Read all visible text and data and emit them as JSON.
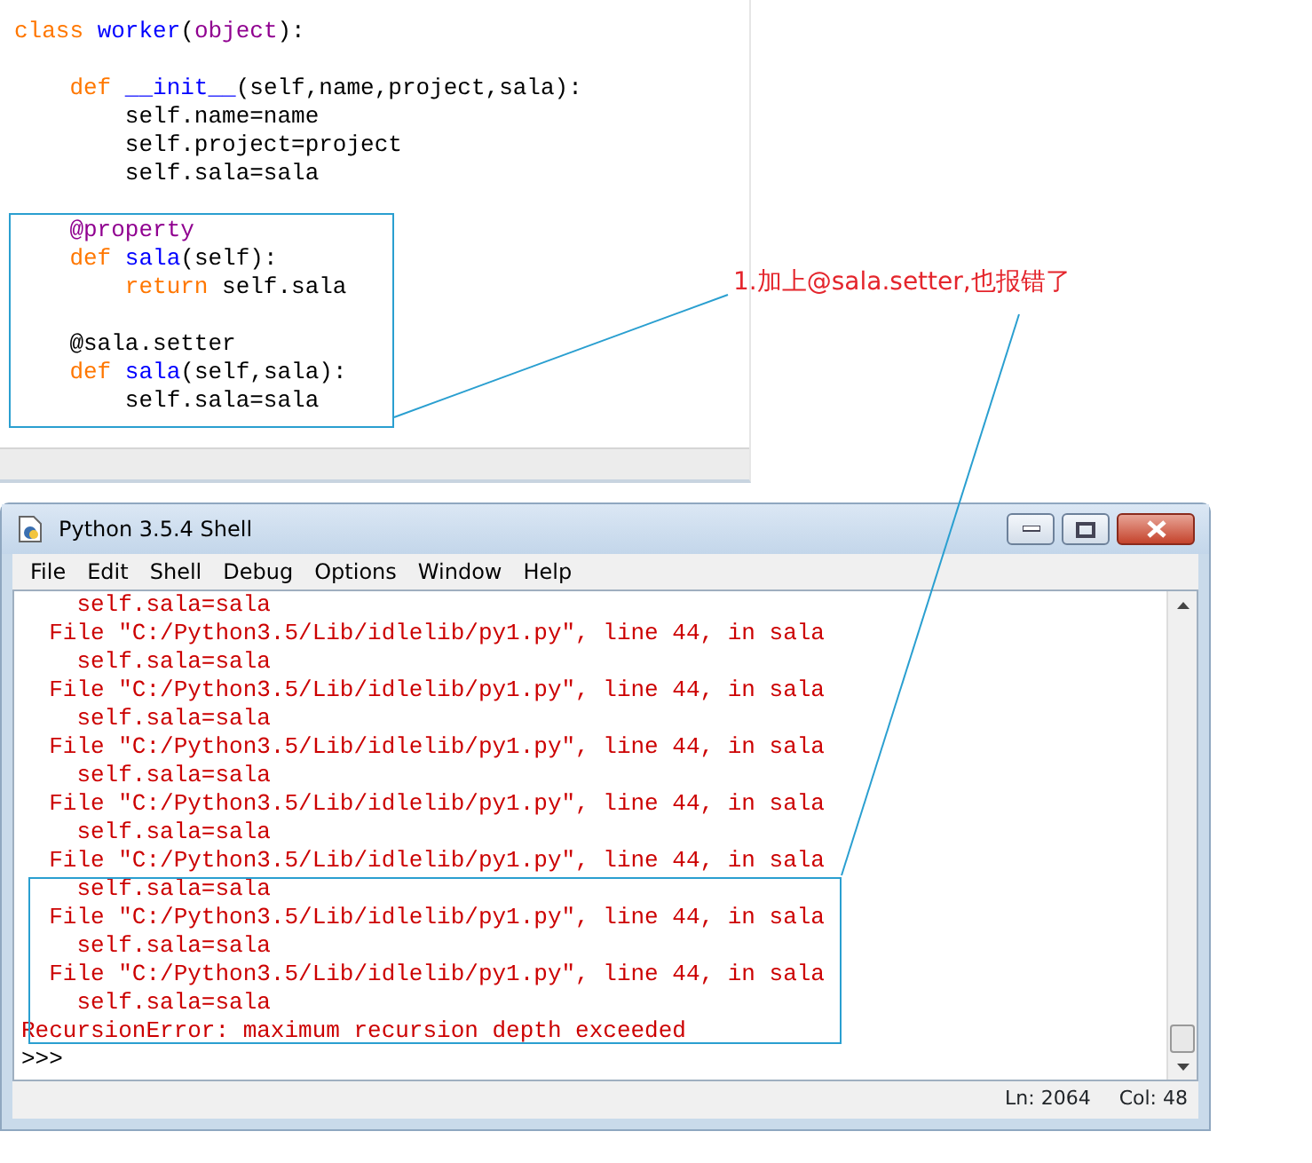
{
  "editor": {
    "lines": [
      {
        "gap_before": false,
        "tokens": [
          {
            "text": "class ",
            "kind": "keyword"
          },
          {
            "text": "worker",
            "kind": "definition"
          },
          {
            "text": "(",
            "kind": "plain"
          },
          {
            "text": "object",
            "kind": "builtin"
          },
          {
            "text": "):",
            "kind": "plain"
          }
        ]
      },
      {
        "gap_before": true,
        "tokens": [
          {
            "text": "    def ",
            "kind": "keyword"
          },
          {
            "text": "__init__",
            "kind": "definition"
          },
          {
            "text": "(self,name,project,sala):",
            "kind": "plain"
          }
        ]
      },
      {
        "gap_before": false,
        "tokens": [
          {
            "text": "        self.name=name",
            "kind": "plain"
          }
        ]
      },
      {
        "gap_before": false,
        "tokens": [
          {
            "text": "        self.project=project",
            "kind": "plain"
          }
        ]
      },
      {
        "gap_before": false,
        "tokens": [
          {
            "text": "        self.sala=sala",
            "kind": "plain"
          }
        ]
      },
      {
        "gap_before": true,
        "tokens": [
          {
            "text": "    @property",
            "kind": "builtin"
          }
        ]
      },
      {
        "gap_before": false,
        "tokens": [
          {
            "text": "    def ",
            "kind": "keyword"
          },
          {
            "text": "sala",
            "kind": "definition"
          },
          {
            "text": "(self):",
            "kind": "plain"
          }
        ]
      },
      {
        "gap_before": false,
        "tokens": [
          {
            "text": "        return",
            "kind": "keyword"
          },
          {
            "text": " self.sala",
            "kind": "plain"
          }
        ]
      },
      {
        "gap_before": true,
        "tokens": [
          {
            "text": "    @sala.setter",
            "kind": "plain"
          }
        ]
      },
      {
        "gap_before": false,
        "tokens": [
          {
            "text": "    def ",
            "kind": "keyword"
          },
          {
            "text": "sala",
            "kind": "definition"
          },
          {
            "text": "(self,sala):",
            "kind": "plain"
          }
        ]
      },
      {
        "gap_before": false,
        "tokens": [
          {
            "text": "        self.sala=sala",
            "kind": "plain"
          }
        ]
      }
    ]
  },
  "shell": {
    "title": "Python 3.5.4 Shell",
    "menu": [
      "File",
      "Edit",
      "Shell",
      "Debug",
      "Options",
      "Window",
      "Help"
    ],
    "output_lines": [
      {
        "text": "    self.sala=sala",
        "kind": "error"
      },
      {
        "text": "  File \"C:/Python3.5/Lib/idlelib/py1.py\", line 44, in sala",
        "kind": "error"
      },
      {
        "text": "    self.sala=sala",
        "kind": "error"
      },
      {
        "text": "  File \"C:/Python3.5/Lib/idlelib/py1.py\", line 44, in sala",
        "kind": "error"
      },
      {
        "text": "    self.sala=sala",
        "kind": "error"
      },
      {
        "text": "  File \"C:/Python3.5/Lib/idlelib/py1.py\", line 44, in sala",
        "kind": "error"
      },
      {
        "text": "    self.sala=sala",
        "kind": "error"
      },
      {
        "text": "  File \"C:/Python3.5/Lib/idlelib/py1.py\", line 44, in sala",
        "kind": "error"
      },
      {
        "text": "    self.sala=sala",
        "kind": "error"
      },
      {
        "text": "  File \"C:/Python3.5/Lib/idlelib/py1.py\", line 44, in sala",
        "kind": "error"
      },
      {
        "text": "    self.sala=sala",
        "kind": "error"
      },
      {
        "text": "  File \"C:/Python3.5/Lib/idlelib/py1.py\", line 44, in sala",
        "kind": "error"
      },
      {
        "text": "    self.sala=sala",
        "kind": "error"
      },
      {
        "text": "  File \"C:/Python3.5/Lib/idlelib/py1.py\", line 44, in sala",
        "kind": "error"
      },
      {
        "text": "    self.sala=sala",
        "kind": "error"
      },
      {
        "text": "RecursionError: maximum recursion depth exceeded",
        "kind": "error"
      },
      {
        "text": ">>>",
        "kind": "prompt"
      }
    ],
    "status": {
      "line": "Ln: 2064",
      "column": "Col: 48"
    }
  },
  "annotation": {
    "text": "1.加上@sala.setter,也报错了"
  }
}
